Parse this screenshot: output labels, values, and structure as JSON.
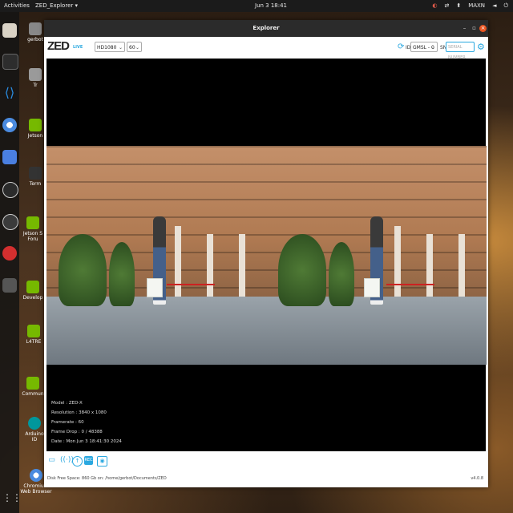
{
  "topbar": {
    "activities": "Activities",
    "app_menu": "ZED_Explorer ▾",
    "clock": "Jun 3  18:41",
    "user": "MAXN"
  },
  "desktop": {
    "icons": [
      {
        "label": "gerbot",
        "icon": "home-icon"
      },
      {
        "label": "Tr",
        "icon": "trash-icon"
      },
      {
        "label": "Jetson",
        "icon": "nvidia-icon"
      },
      {
        "label": "Term",
        "icon": "terminal-icon"
      },
      {
        "label": "Jetson S Foru",
        "icon": "nvidia-icon"
      },
      {
        "label": "Develop",
        "icon": "nvidia-icon"
      },
      {
        "label": "L4TRE",
        "icon": "nvidia-icon"
      },
      {
        "label": "Commun",
        "icon": "nvidia-icon"
      },
      {
        "label": "Arduino ID",
        "icon": "arduino-icon"
      },
      {
        "label": "Chromium Web Browser",
        "icon": "chromium-icon"
      }
    ]
  },
  "window": {
    "title": "Explorer",
    "logo": "ZED",
    "live": "LIVE",
    "resolution_select": "HD1080",
    "fps_select": "60",
    "id_label": "ID",
    "camera_select": "GMSL - 0",
    "sn_label": "SN",
    "sn_placeholder": "SERIAL NUMBER"
  },
  "info": {
    "model": "Model : ZED-X",
    "resolution": "Resolution : 3840 x 1080",
    "framerate": "Framerate : 60",
    "frame_drop": "Frame Drop : 0 / 48388",
    "date": "Date : Mon Jun 3 18:41:30 2024"
  },
  "footer": {
    "disk_space": "Disk Free Space: 860 Gb  on: /home/gerbot/Documents/ZED",
    "version": "v4.0.8"
  },
  "colors": {
    "accent": "#2aa8e0",
    "close": "#e95420"
  }
}
